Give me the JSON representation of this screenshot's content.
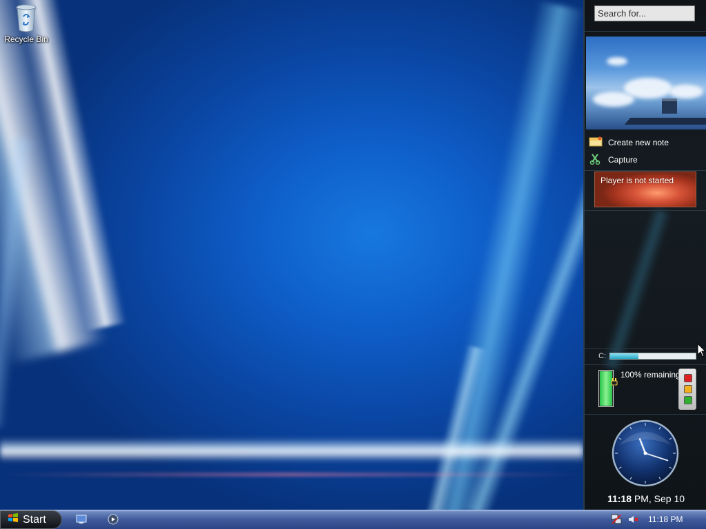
{
  "desktop": {
    "icons": [
      {
        "label": "Recycle Bin",
        "icon": "recycle-bin-icon"
      }
    ]
  },
  "sidebar": {
    "search": {
      "placeholder": "Search for..."
    },
    "notes": {
      "create_label": "Create new note",
      "capture_label": "Capture"
    },
    "media_player": {
      "status": "Player is not started"
    },
    "drive": {
      "label": "C:",
      "used_fraction": 0.33
    },
    "battery": {
      "text": "100% remaining",
      "level_fraction": 1.0
    },
    "traffic_lights": [
      "#e02020",
      "#f0b020",
      "#30b030"
    ],
    "clock": {
      "time_bold": "11:18",
      "time_rest": " PM, Sep 10",
      "hour": 11,
      "minute": 18
    }
  },
  "taskbar": {
    "start_label": "Start",
    "quicklaunch": [
      "show-desktop-icon",
      "media-player-icon"
    ],
    "tray_icons": [
      "network-icon",
      "volume-muted-icon"
    ],
    "time": "11:18 PM"
  }
}
